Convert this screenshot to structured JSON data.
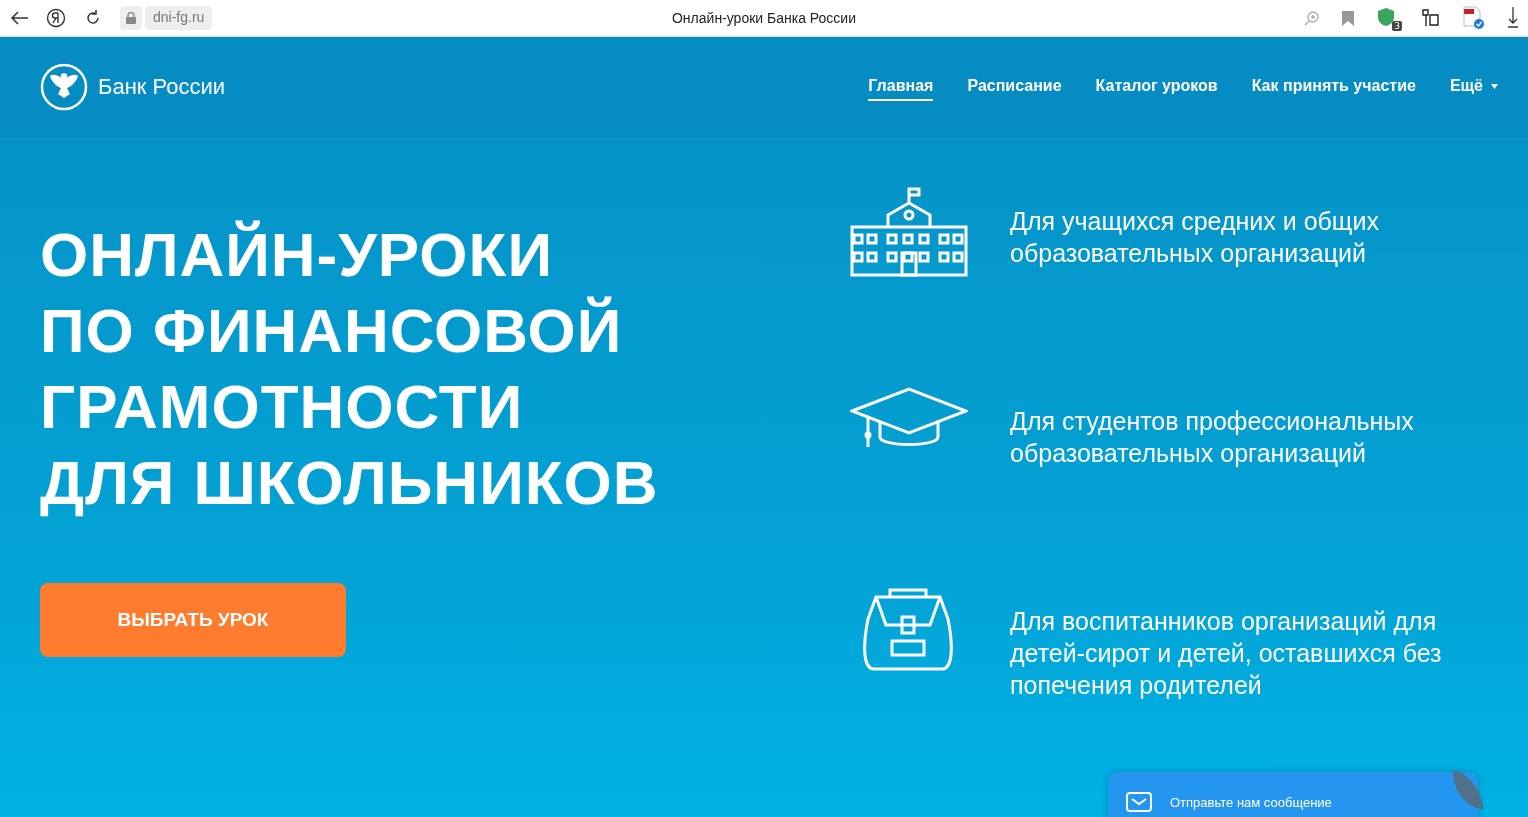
{
  "browser": {
    "address": "dni-fg.ru",
    "page_title": "Онлайн-уроки Банка России",
    "extension_badge": "3"
  },
  "header": {
    "logo_text": "Банк России",
    "nav": [
      {
        "label": "Главная",
        "selected": true
      },
      {
        "label": "Расписание",
        "selected": false
      },
      {
        "label": "Каталог уроков",
        "selected": false
      },
      {
        "label": "Как принять участие",
        "selected": false
      },
      {
        "label": "Ещё",
        "selected": false,
        "dropdown": true
      }
    ]
  },
  "hero": {
    "title_lines": [
      "ОНЛАЙН-УРОКИ",
      "ПО ФИНАНСОВОЙ",
      "ГРАМОТНОСТИ",
      "ДЛЯ ШКОЛЬНИКОВ"
    ],
    "button": "ВЫБРАТЬ УРОК",
    "audiences": [
      {
        "kind": "school",
        "text": "Для учащихся средних и общих образовательных организаций"
      },
      {
        "kind": "cap",
        "text": "Для студентов профессиональных образовательных организаций"
      },
      {
        "kind": "backpack",
        "text": "Для воспитанников организаций для детей-сирот и детей, оставшихся без попечения родителей"
      }
    ]
  },
  "chat_widget": {
    "label": "Отправьте нам сообщение"
  }
}
